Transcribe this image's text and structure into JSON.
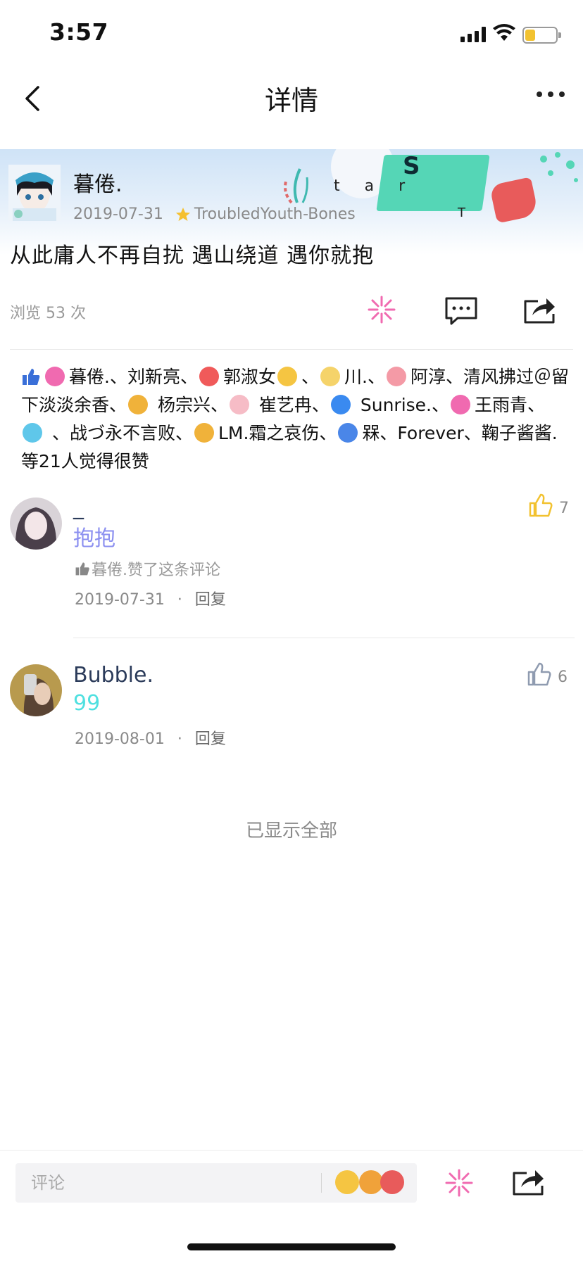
{
  "status_bar": {
    "time": "3:57"
  },
  "nav": {
    "title": "详情"
  },
  "post": {
    "author": "暮倦.",
    "date": "2019-07-31",
    "badge_text": "TroubledYouth-Bones",
    "content": "从此庸人不再自扰 遇山绕道 遇你就抱",
    "views": "浏览 53 次",
    "banner_letters": {
      "s": "S",
      "tar": "t a r",
      "t": "T"
    }
  },
  "likes": {
    "segments": [
      {
        "name": "暮倦.、",
        "icon": "flower-icon",
        "color": "#f06ab0"
      },
      {
        "name": "刘新亮、",
        "icon": null
      },
      {
        "name": "郭淑女",
        "icon": "heart-icon",
        "color": "#f05a5a"
      },
      {
        "name": "、",
        "icon": "angel-emoji-icon",
        "color": "#f5c542"
      },
      {
        "name": "川.、",
        "icon": "egg-icon",
        "color": "#f5d36a"
      },
      {
        "name": "阿淳、清风拂过＠留下淡淡余香、",
        "icon": "love-icon",
        "color": "#f49aa6"
      },
      {
        "name": " 杨宗兴、",
        "icon": "sun-icon",
        "color": "#f0b23a"
      },
      {
        "name": " 崔艺冉、",
        "icon": "cute-icon",
        "color": "#f6bcc6"
      },
      {
        "name": " Sunrise.、",
        "icon": "bell-icon",
        "color": "#3a8af0"
      },
      {
        "name": "王雨青、",
        "icon": "smile-icon",
        "color": "#f06ab0"
      },
      {
        "name": " 、战づ永不言败、",
        "icon": "crown-icon",
        "color": "#5fc7ea"
      },
      {
        "name": "LM.霜之哀伤、",
        "icon": "beer-icon",
        "color": "#f0b23a"
      },
      {
        "name": "槑、Forever、鞠子酱酱.等21人觉得很赞",
        "icon": "fish-icon",
        "color": "#4a86e8"
      }
    ]
  },
  "comments": [
    {
      "name": "_",
      "text": "抱抱",
      "text_color": "#8b8ff0",
      "liked_by": "暮倦.赞了这条评论",
      "date": "2019-07-31",
      "reply": "回复",
      "likes": "7",
      "thumb_color": "#f2c230"
    },
    {
      "name": "Bubble.",
      "text": "99",
      "text_color": "#4fe0e0",
      "date": "2019-08-01",
      "reply": "回复",
      "likes": "6",
      "thumb_color": "#8f9bb0"
    }
  ],
  "footer": {
    "all_shown": "已显示全部"
  },
  "bottom_bar": {
    "comment_placeholder": "评论"
  }
}
